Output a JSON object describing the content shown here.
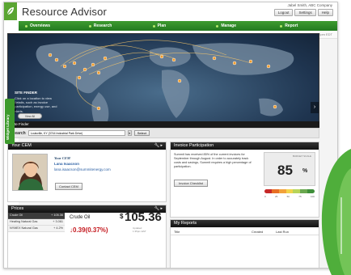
{
  "app": {
    "title": "Resource Advisor",
    "user_line": "Jabel Smith, ABC Company",
    "header_buttons": [
      "Logout",
      "Settings",
      "Help"
    ]
  },
  "nav": {
    "items": [
      "Overviews",
      "Research",
      "Plan",
      "Manage",
      "Report"
    ]
  },
  "breadcrumb": {
    "path": "Home > Dashboard/Home",
    "date": "11 Jul 2012 3:22pm EDT"
  },
  "map": {
    "callout_title": "SITE FINDER",
    "callout_text": "Click on a location to view details, such as invoice participation, energy use, and alerts.",
    "toggle_label": "View All",
    "prev_icon": "chevron-left-icon",
    "next_icon": "chevron-right-icon"
  },
  "side_tab": {
    "label": "Widget Library"
  },
  "site_finder": {
    "header": "Site Finder",
    "search_label": "Search",
    "search_value": "Louisville, KY (3744 Industrial Park Drive)",
    "select_button": "Select"
  },
  "cem": {
    "header": "Your CEM",
    "role": "Your CEM",
    "name": "Lana Isaacson",
    "email": "lana.isaacson@summitenergy.com",
    "contact_button": "Contact CEM"
  },
  "invoice": {
    "header": "Invoice Participation",
    "text": "Summit has received 85% of the current invoices for September through August. In order to accurately track costs and savings, Summit requires a high percentage of participation.",
    "button": "Invoice Checklist",
    "score_caption": "BUDGET SCALE",
    "score": "85",
    "score_unit": "%",
    "meter_ticks": [
      "0",
      "25",
      "50",
      "75",
      "100"
    ],
    "meter_colors": [
      "#c62828",
      "#e76f24",
      "#f2a23a",
      "#f1d34a",
      "#b8d45a",
      "#6aa84f",
      "#3f8f3a"
    ]
  },
  "prices": {
    "header": "Prices",
    "rows": [
      {
        "name": "Crude Oil",
        "value": "+ 105.36"
      },
      {
        "name": "Heating Natural Gas",
        "value": "+ 3.061"
      },
      {
        "name": "NYMEX Natural Gas",
        "value": "+ 4.2%"
      }
    ],
    "detail_name": "Crude Oil",
    "detail_dollar": "$",
    "detail_price": "105.36",
    "detail_change": "0.39(0.37%)",
    "detail_updated": "Updated\n1:35pm EST"
  },
  "reports": {
    "header": "My Reports",
    "columns": [
      "Title",
      "Created",
      "Last Run"
    ]
  }
}
